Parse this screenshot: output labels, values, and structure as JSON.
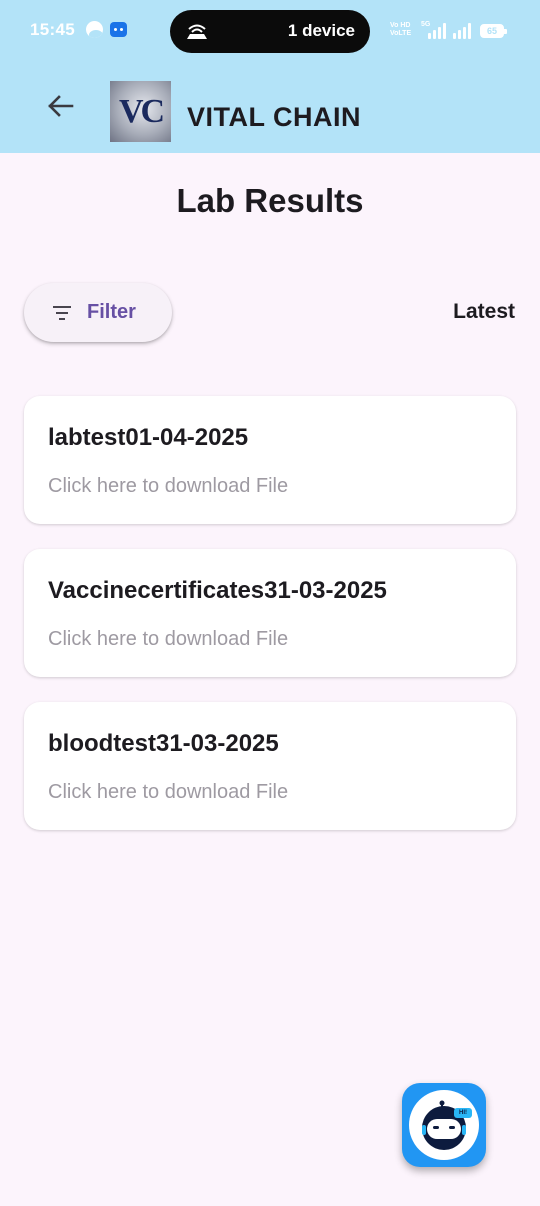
{
  "status_bar": {
    "time": "15:45",
    "pill_text": "1 device",
    "network_label_1": "Vo HD",
    "network_label_2": "VoLTE",
    "network_type": "5G",
    "battery": "65"
  },
  "app_bar": {
    "logo_text": "VC",
    "title": "VITAL CHAIN"
  },
  "page": {
    "title": "Lab Results"
  },
  "toolbar": {
    "filter_label": "Filter",
    "sort_label": "Latest"
  },
  "results": [
    {
      "title": "labtest01-04-2025",
      "subtitle": "Click here to download File"
    },
    {
      "title": "Vaccinecertificates31-03-2025",
      "subtitle": "Click here to download File"
    },
    {
      "title": "bloodtest31-03-2025",
      "subtitle": "Click here to download File"
    }
  ],
  "fab": {
    "badge": "HI!"
  },
  "colors": {
    "header_bg": "#b3e3f8",
    "page_bg": "#fcf4fc",
    "accent": "#6750a4",
    "fab_bg": "#2196f3"
  },
  "icons": {
    "back": "arrow-left-icon",
    "filter": "filter-lines-icon",
    "fab": "chatbot-robot-icon"
  }
}
